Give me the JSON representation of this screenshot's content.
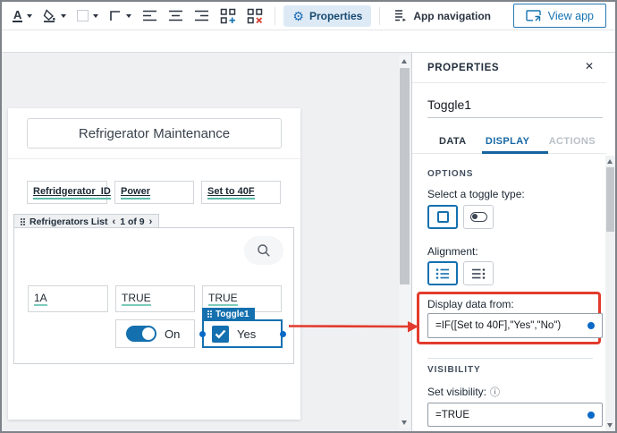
{
  "toolbar": {
    "font_color_letter": "A",
    "properties_label": "Properties",
    "app_navigation_label": "App navigation",
    "view_app_label": "View app"
  },
  "canvas": {
    "form_title": "Refrigerator Maintenance",
    "column_headers": [
      "Refridgerator_ID",
      "Power",
      "Set to 40F"
    ],
    "list_section": {
      "label": "Refrigerators List",
      "pagination": "1 of 9"
    },
    "row_values": [
      "1A",
      "TRUE",
      "TRUE"
    ],
    "toggle_switch_label": "On",
    "selected_control": {
      "tag": "Toggle1",
      "value_label": "Yes"
    }
  },
  "properties_panel": {
    "title": "PROPERTIES",
    "control_name": "Toggle1",
    "tabs": [
      {
        "label": "DATA",
        "active": false
      },
      {
        "label": "DISPLAY",
        "active": true
      },
      {
        "label": "ACTIONS",
        "active": false
      }
    ],
    "options": {
      "heading": "OPTIONS",
      "toggle_type_label": "Select a toggle type:",
      "alignment_label": "Alignment:"
    },
    "display_data": {
      "label": "Display data from:",
      "formula": "=IF([Set to 40F],\"Yes\",\"No\")"
    },
    "visibility": {
      "heading": "VISIBILITY",
      "label": "Set visibility:",
      "formula": "=TRUE"
    }
  },
  "colors": {
    "accent_blue": "#1470af",
    "highlight_red": "#e23b2d",
    "formula_teal": "#5bbcab",
    "binding_dot_blue": "#0b69c7"
  }
}
